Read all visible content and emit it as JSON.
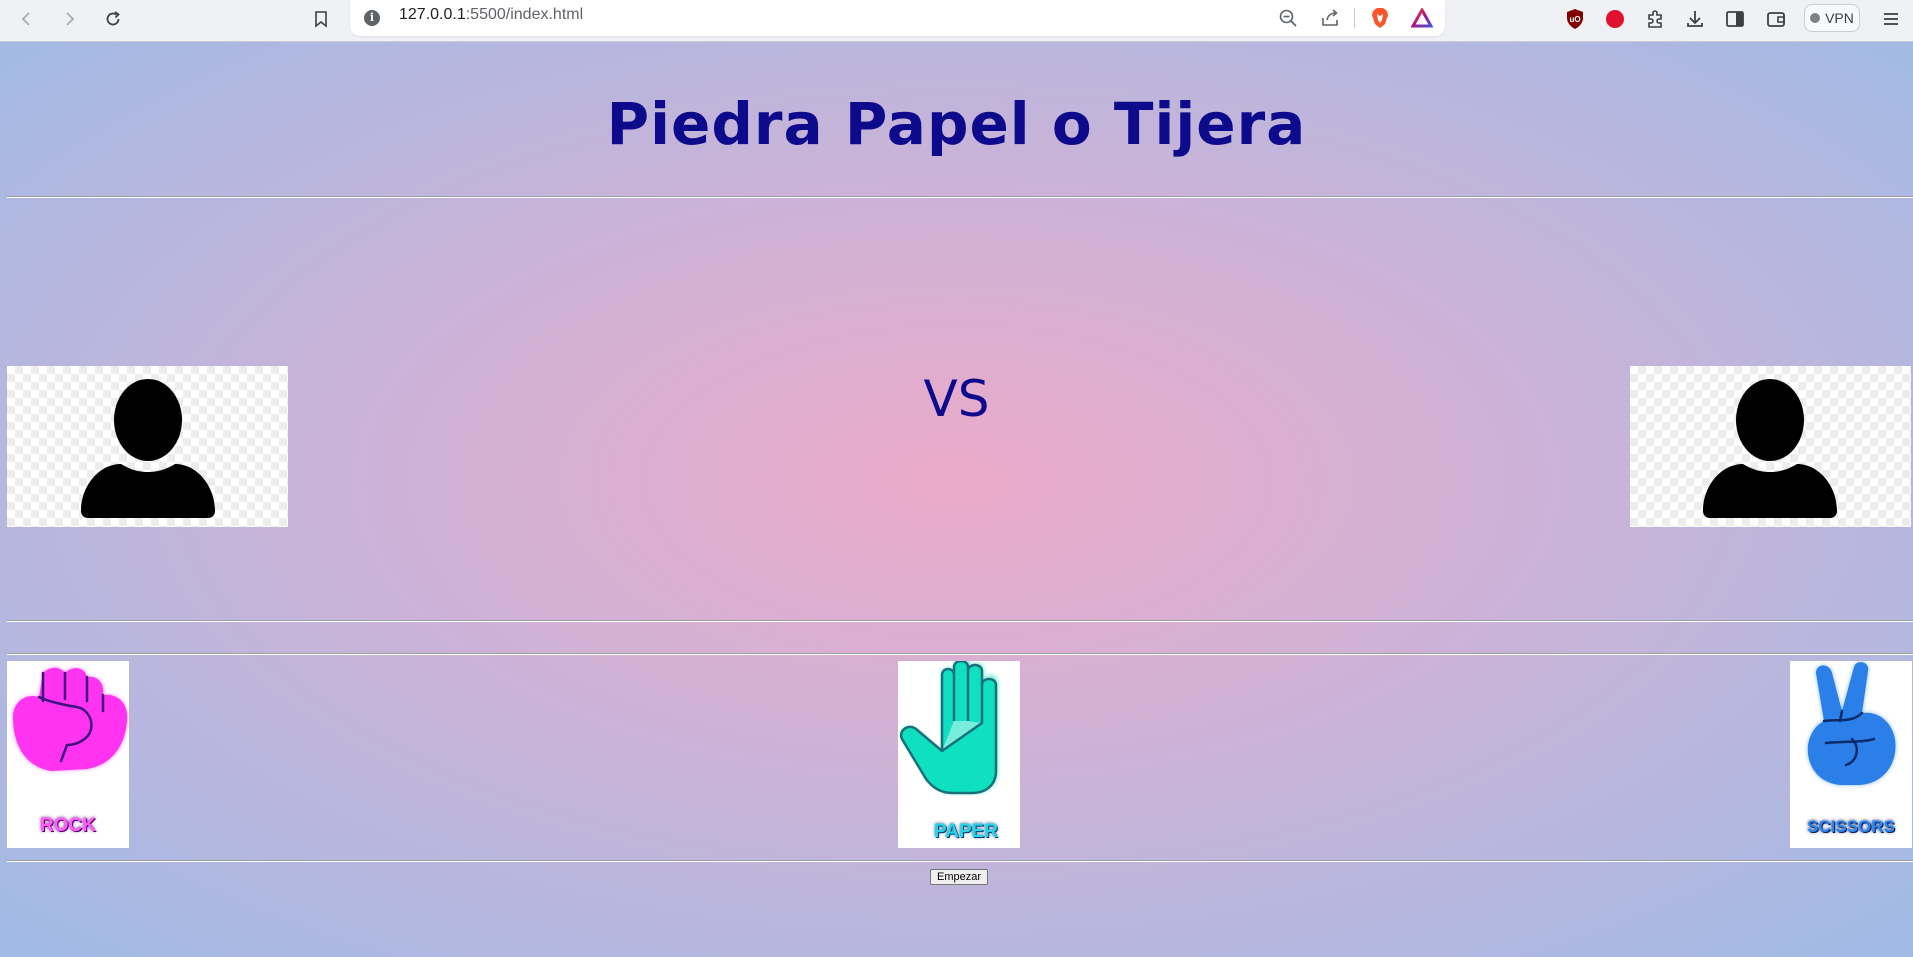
{
  "browser": {
    "url_host": "127.0.0.1",
    "url_path": ":5500/index.html",
    "vpn_label": "VPN",
    "icons": [
      "back-icon",
      "forward-icon",
      "reload-icon",
      "bookmark-icon",
      "site-info-icon",
      "zoom-out-icon",
      "share-icon",
      "brave-shields-icon",
      "brave-rewards-icon",
      "ublock-icon",
      "record-icon",
      "extensions-icon",
      "downloads-icon",
      "sidebar-icon",
      "wallet-icon",
      "menu-icon"
    ]
  },
  "page": {
    "title": "Piedra Papel o Tijera",
    "vs_text": "VS",
    "choices": [
      {
        "label": "ROCK",
        "color": "#ff33f0"
      },
      {
        "label": "PAPER",
        "color": "#0fe0c0"
      },
      {
        "label": "SCISSORS",
        "color": "#2a7fe8"
      }
    ],
    "start_label": "Empezar"
  },
  "colors": {
    "title": "#0e0a8c",
    "background_center": "#ecaac9",
    "background_edge": "#9fbbe6"
  }
}
